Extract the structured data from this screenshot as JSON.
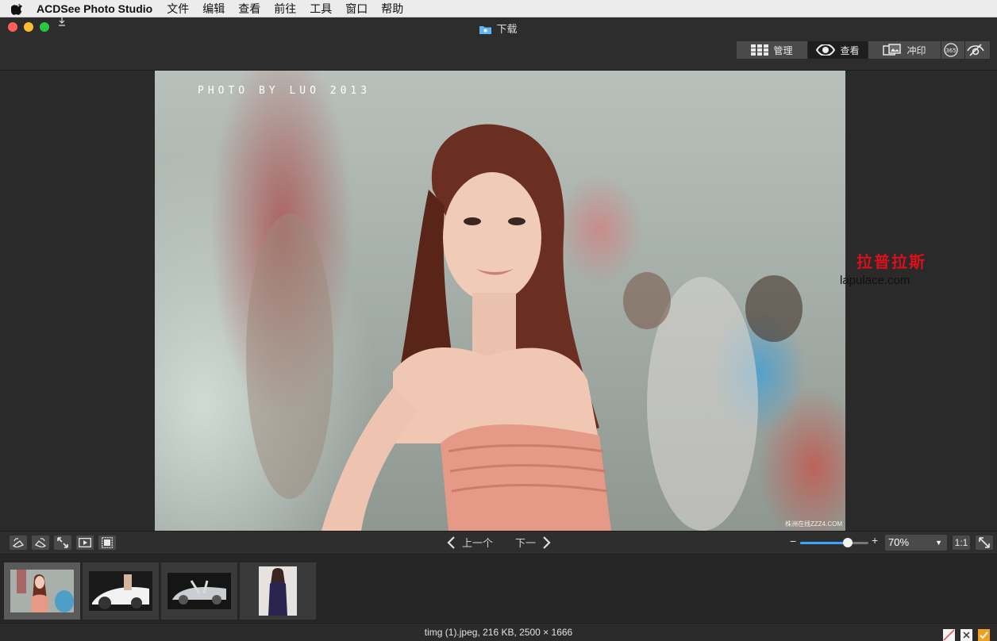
{
  "menubar": {
    "app_name": "ACDSee Photo Studio",
    "items": [
      "文件",
      "编辑",
      "查看",
      "前往",
      "工具",
      "窗口",
      "帮助"
    ]
  },
  "window": {
    "title": "下载",
    "modes": [
      {
        "label": "管理",
        "icon": "grid-icon"
      },
      {
        "label": "查看",
        "icon": "eye-icon",
        "active": true
      },
      {
        "label": "冲印",
        "icon": "develop-icon"
      }
    ]
  },
  "photo": {
    "watermark_top": "PHOTO BY LUO 2013",
    "watermark_bottom": "株洲在线ZZZ4.COM"
  },
  "stamp": {
    "chinese": "拉普拉斯",
    "url": "lapulace.com"
  },
  "toolbar": {
    "prev_label": "上一个",
    "next_label": "下一",
    "zoom_minus": "−",
    "zoom_plus": "+",
    "zoom_value": "70%",
    "zoom_level": 0.7,
    "actual_size_label": "1:1"
  },
  "filmstrip": {
    "selected_index": 0,
    "count": 4
  },
  "status": {
    "text": "timg (1).jpeg, 216 KB, 2500 × 1666"
  },
  "colors": {
    "accent": "#3ea2ff",
    "stamp_red": "#d8111b",
    "reject": "#e05a5a",
    "accept": "#f0a020"
  }
}
